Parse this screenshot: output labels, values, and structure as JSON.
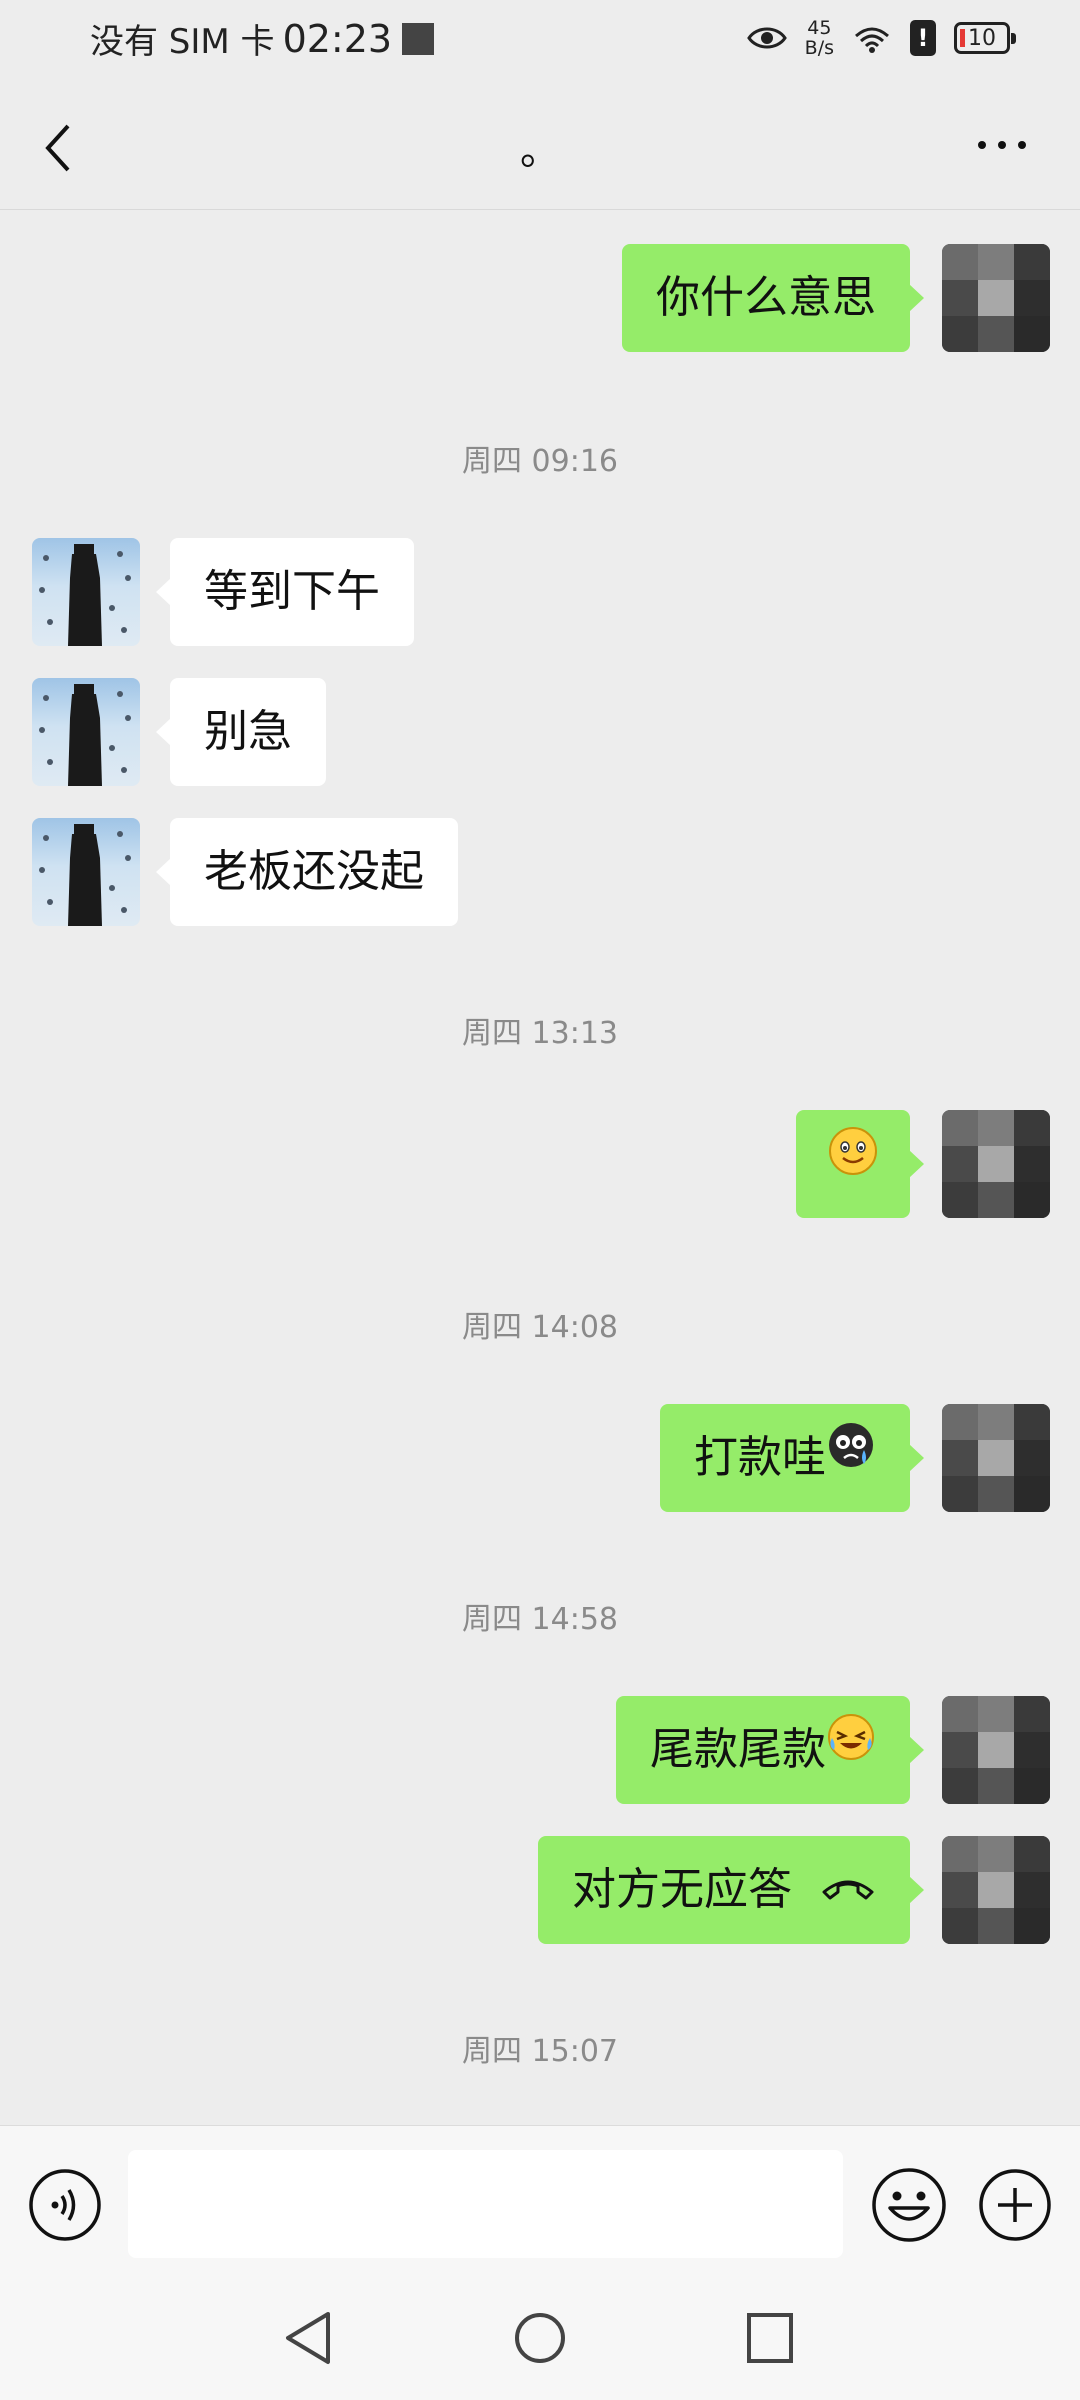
{
  "status_bar": {
    "carrier": "没有 SIM 卡",
    "time": "02:23",
    "net_speed_value": "45",
    "net_speed_unit": "B/s",
    "alert": "!",
    "battery_level": "10"
  },
  "header": {
    "title": "。"
  },
  "messages": [
    {
      "type": "text",
      "sender": "self",
      "text": "你什么意思"
    },
    {
      "type": "time",
      "text": "周四 09:16"
    },
    {
      "type": "text",
      "sender": "other",
      "text": "等到下午"
    },
    {
      "type": "text",
      "sender": "other",
      "text": "别急"
    },
    {
      "type": "text",
      "sender": "other",
      "text": "老板还没起"
    },
    {
      "type": "time",
      "text": "周四 13:13"
    },
    {
      "type": "emoji",
      "sender": "self",
      "icon": "smile-emoji-icon"
    },
    {
      "type": "time",
      "text": "周四 14:08"
    },
    {
      "type": "text",
      "sender": "self",
      "text": "打款哇",
      "icon": "crying-emoji-icon"
    },
    {
      "type": "time",
      "text": "周四 14:58"
    },
    {
      "type": "text",
      "sender": "self",
      "text": "尾款尾款",
      "icon": "tears-of-joy-emoji-icon"
    },
    {
      "type": "call",
      "sender": "self",
      "text": "对方无应答",
      "icon": "phone-hangup-icon"
    },
    {
      "type": "time",
      "text": "周四 15:07"
    }
  ],
  "input_bar": {
    "placeholder": ""
  },
  "colors": {
    "background": "#ededed",
    "sent_bubble": "#95ec69",
    "received_bubble": "#ffffff",
    "timestamp": "#8a8a8a"
  }
}
